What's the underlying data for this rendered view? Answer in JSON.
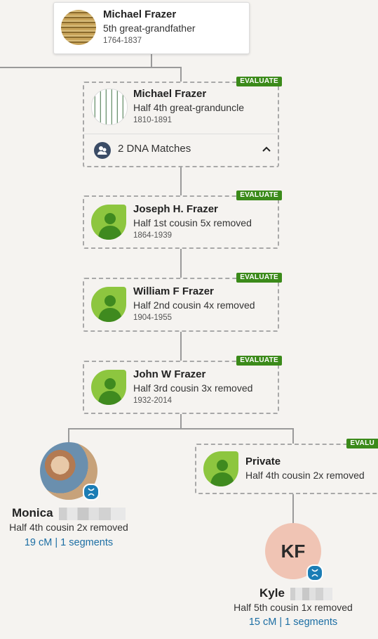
{
  "persons": [
    {
      "name": "Michael Frazer",
      "relationship": "5th great-grandfather",
      "dates": "1764-1837"
    },
    {
      "name": "Michael Frazer",
      "relationship": "Half 4th great-granduncle",
      "dates": "1810-1891",
      "badge": "EVALUATE",
      "dna_matches": "2 DNA Matches"
    },
    {
      "name": "Joseph H. Frazer",
      "relationship": "Half 1st cousin 5x removed",
      "dates": "1864-1939",
      "badge": "EVALUATE"
    },
    {
      "name": "William F Frazer",
      "relationship": "Half 2nd cousin 4x removed",
      "dates": "1904-1955",
      "badge": "EVALUATE"
    },
    {
      "name": "John W Frazer",
      "relationship": "Half 3rd cousin 3x removed",
      "dates": "1932-2014",
      "badge": "EVALUATE"
    },
    {
      "name": "Private",
      "relationship": "Half 4th cousin 2x removed",
      "badge": "EVALU"
    }
  ],
  "matches": [
    {
      "first_name": "Monica",
      "relationship": "Half 4th cousin 2x removed",
      "shared": "19 cM | 1 segments"
    },
    {
      "first_name": "Kyle",
      "initials": "KF",
      "relationship": "Half 5th cousin 1x removed",
      "shared": "15 cM | 1 segments"
    }
  ],
  "colors": {
    "badge": "#3b8a1a",
    "link": "#1c6ea4",
    "leaf": "#8dc63f",
    "kf_avatar": "#f0c4b4"
  }
}
